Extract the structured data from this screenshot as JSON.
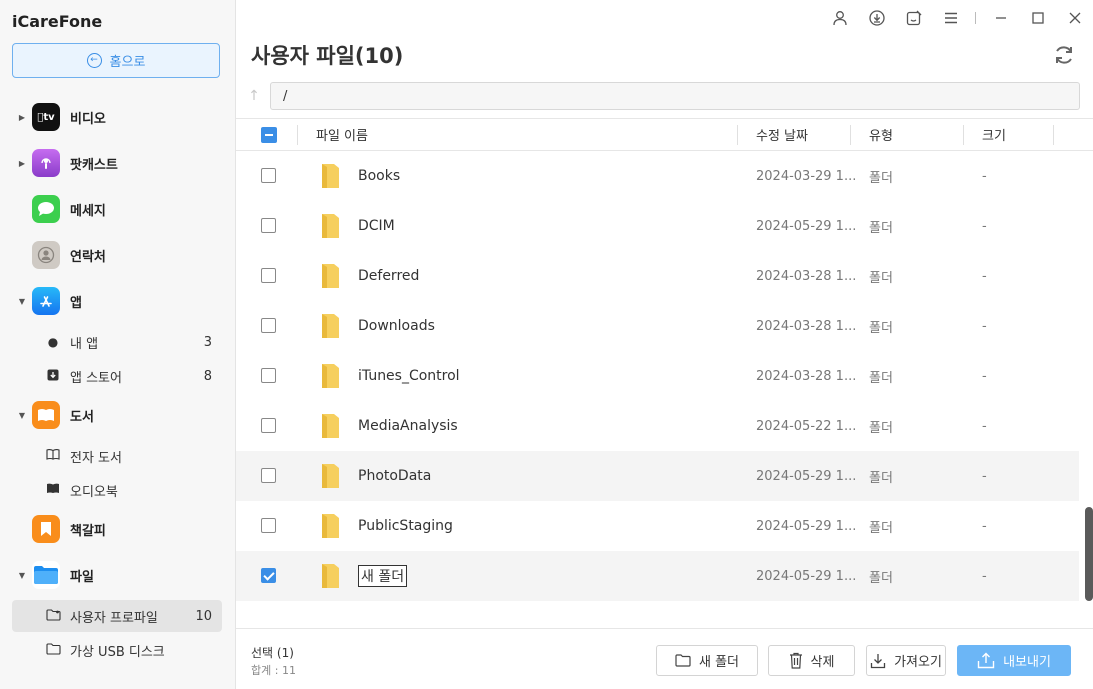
{
  "app": {
    "title": "iCareFone"
  },
  "sidebar": {
    "home_label": "홈으로",
    "items": [
      {
        "label": "비디오",
        "has_caret": true,
        "caret": "▶"
      },
      {
        "label": "팟캐스트",
        "has_caret": true,
        "caret": "▶"
      },
      {
        "label": "메세지",
        "has_caret": false,
        "caret": ""
      },
      {
        "label": "연락처",
        "has_caret": false,
        "caret": ""
      },
      {
        "label": "앱",
        "has_caret": true,
        "caret": "▼"
      },
      {
        "label": "도서",
        "has_caret": true,
        "caret": "▼"
      },
      {
        "label": "책갈피",
        "has_caret": false,
        "caret": ""
      },
      {
        "label": "파일",
        "has_caret": true,
        "caret": "▼"
      }
    ],
    "video_icon_text": "tv",
    "sub_items": {
      "my_apps": {
        "label": "내 앱",
        "count": "3"
      },
      "app_store": {
        "label": "앱 스토어",
        "count": "8"
      },
      "ebooks": {
        "label": "전자 도서"
      },
      "audiobooks": {
        "label": "오디오북"
      },
      "user_profile": {
        "label": "사용자 프로파일",
        "count": "10"
      },
      "virtual_usb": {
        "label": "가상 USB 디스크"
      }
    }
  },
  "main": {
    "title": "사용자 파일(10)",
    "path": "/",
    "columns": {
      "name": "파일 이름",
      "date": "수정 날짜",
      "type": "유형",
      "size": "크기"
    },
    "rows": [
      {
        "name": "Books",
        "date": "2024-03-29 1...",
        "type": "폴더",
        "size": "-",
        "checked": false
      },
      {
        "name": "DCIM",
        "date": "2024-05-29 1...",
        "type": "폴더",
        "size": "-",
        "checked": false
      },
      {
        "name": "Deferred",
        "date": "2024-03-28 1...",
        "type": "폴더",
        "size": "-",
        "checked": false
      },
      {
        "name": "Downloads",
        "date": "2024-03-28 1...",
        "type": "폴더",
        "size": "-",
        "checked": false
      },
      {
        "name": "iTunes_Control",
        "date": "2024-03-28 1...",
        "type": "폴더",
        "size": "-",
        "checked": false
      },
      {
        "name": "MediaAnalysis",
        "date": "2024-05-22 1...",
        "type": "폴더",
        "size": "-",
        "checked": false
      },
      {
        "name": "PhotoData",
        "date": "2024-05-29 1...",
        "type": "폴더",
        "size": "-",
        "checked": false
      },
      {
        "name": "PublicStaging",
        "date": "2024-05-29 1...",
        "type": "폴더",
        "size": "-",
        "checked": false
      },
      {
        "name": "새 폴더",
        "date": "2024-05-29 1...",
        "type": "폴더",
        "size": "-",
        "checked": true
      }
    ]
  },
  "footer": {
    "selected": "선택 (1)",
    "total": "합계 : 11",
    "new_folder": "새 폴더",
    "delete": "삭제",
    "import": "가져오기",
    "export": "내보내기"
  },
  "colors": {
    "accent": "#3a8ee6",
    "export_button": "#6cb6f6",
    "folder": "#f6cf5e"
  },
  "icons": [
    "user-icon",
    "download-icon",
    "feedback-icon",
    "menu-icon",
    "minimize-icon",
    "maximize-icon",
    "close-icon",
    "refresh-icon",
    "up-arrow-icon",
    "folder-icon"
  ]
}
